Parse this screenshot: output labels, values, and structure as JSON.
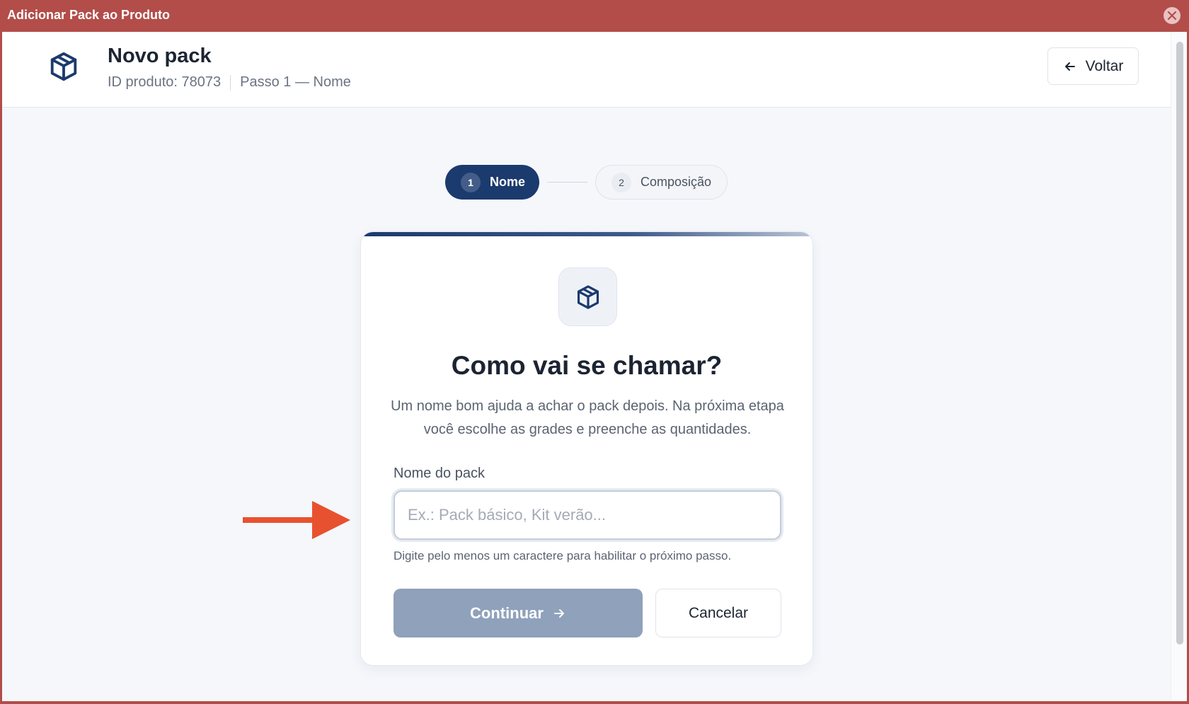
{
  "window": {
    "title": "Adicionar Pack ao Produto"
  },
  "header": {
    "title": "Novo pack",
    "product_id": "ID produto: 78073",
    "step_text": "Passo 1 — Nome",
    "back_label": "Voltar"
  },
  "stepper": {
    "steps": [
      {
        "number": "1",
        "label": "Nome",
        "active": true
      },
      {
        "number": "2",
        "label": "Composição",
        "active": false
      }
    ]
  },
  "card": {
    "title": "Como vai se chamar?",
    "description": "Um nome bom ajuda a achar o pack depois. Na próxima etapa você escolhe as grades e preenche as quantidades.",
    "field_label": "Nome do pack",
    "field_placeholder": "Ex.: Pack básico, Kit verão...",
    "field_value": "",
    "field_hint": "Digite pelo menos um caractere para habilitar o próximo passo.",
    "continue_label": "Continuar",
    "cancel_label": "Cancelar"
  },
  "colors": {
    "titlebar": "#b24d4a",
    "primary": "#1b3a6e",
    "continue_disabled": "#8fa1bb",
    "arrow": "#e8512f"
  },
  "icons": [
    "close-icon",
    "package-icon",
    "arrow-left-icon",
    "arrow-right-icon"
  ]
}
